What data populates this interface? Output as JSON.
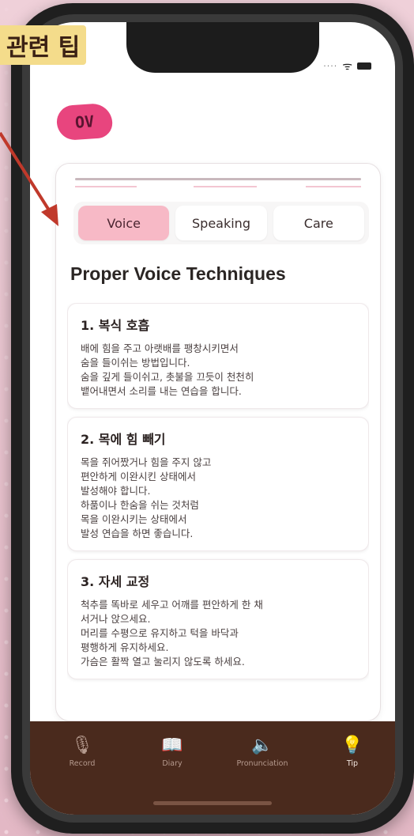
{
  "annotation": {
    "callout_text": "관련 팁"
  },
  "brand": {
    "logo_text": "OV"
  },
  "tabs": [
    {
      "label": "Voice",
      "active": true
    },
    {
      "label": "Speaking",
      "active": false
    },
    {
      "label": "Care",
      "active": false
    }
  ],
  "content": {
    "heading": "Proper Voice Techniques",
    "tips": [
      {
        "title": "1. 복식 호흡",
        "lines": [
          "배에 힘을 주고 아랫배를 팽창시키면서",
          "숨을 들이쉬는 방법입니다.",
          "숨을 깊게 들이쉬고, 촛불을 끄듯이 천천히",
          "뱉어내면서 소리를 내는 연습을 합니다."
        ]
      },
      {
        "title": "2. 목에 힘 빼기",
        "lines": [
          "목을 쥐어짰거나 힘을 주지 않고",
          "편안하게 이완시킨 상태에서",
          "발성해야 합니다.",
          "하품이나 한숨을 쉬는 것처럼",
          "목을 이완시키는 상태에서",
          "발성 연습을 하면 좋습니다."
        ]
      },
      {
        "title": "3. 자세 교정",
        "lines": [
          "척추를 똑바로 세우고 어깨를 편안하게 한 채",
          "서거나 앉으세요.",
          "머리를 수평으로 유지하고 턱을 바닥과",
          "평행하게 유지하세요.",
          "가슴은 활짝 열고 눌리지 않도록 하세요."
        ]
      }
    ]
  },
  "tabbar": {
    "items": [
      {
        "label": "Record",
        "icon": "microphone-icon",
        "glyph": "🎙"
      },
      {
        "label": "Diary",
        "icon": "book-icon",
        "glyph": "📖"
      },
      {
        "label": "Pronunciation",
        "icon": "speaker-icon",
        "glyph": "🔈"
      },
      {
        "label": "Tip",
        "icon": "lightbulb-icon",
        "glyph": "💡",
        "active": true
      }
    ]
  },
  "colors": {
    "accent_pink": "#f7b9c6",
    "tabbar_brown": "#4a2a1d",
    "logo_pink": "#e8457e",
    "callout_yellow": "#f4dc8b",
    "arrow_red": "#c0392b"
  }
}
